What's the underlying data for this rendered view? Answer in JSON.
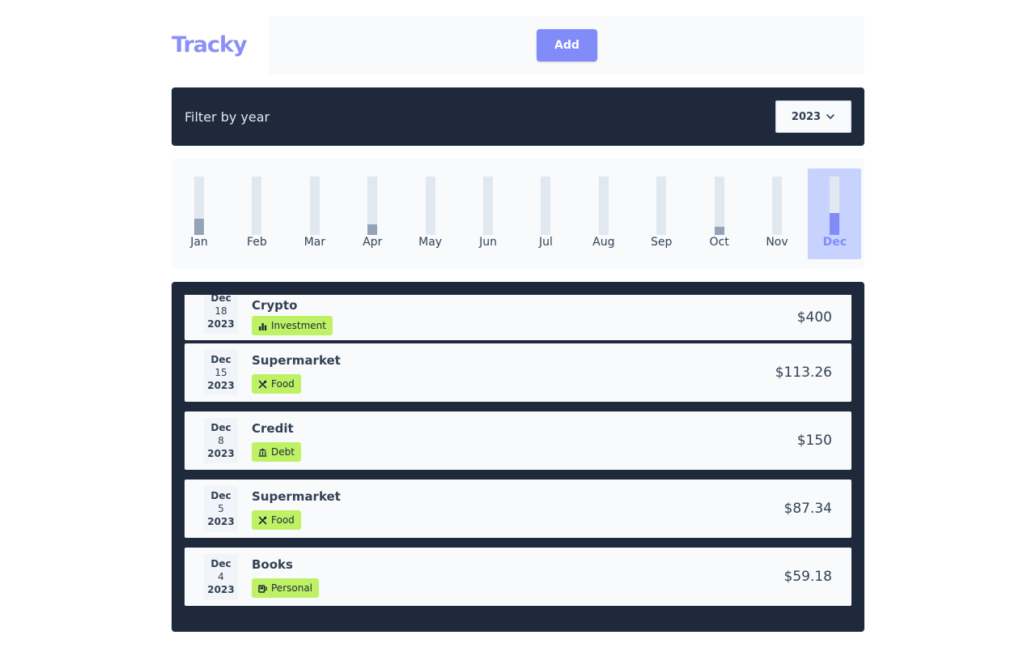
{
  "app": {
    "logo": "Tracky"
  },
  "header": {
    "add_label": "Add"
  },
  "filter": {
    "label": "Filter by year",
    "selected_year": "2023"
  },
  "colors": {
    "brand": "#8b8ff8",
    "accent": "#818cf8",
    "dark": "#1e293b",
    "bar_track": "#e2e8f0",
    "bar_fill": "#94a3b8",
    "selected_bg": "#c7d2fe",
    "badge": "#bef264"
  },
  "chart_data": {
    "type": "bar",
    "categories": [
      "Jan",
      "Feb",
      "Mar",
      "Apr",
      "May",
      "Jun",
      "Jul",
      "Aug",
      "Sep",
      "Oct",
      "Nov",
      "Dec"
    ],
    "values": [
      0.28,
      0,
      0,
      0.18,
      0,
      0,
      0,
      0,
      0,
      0.14,
      0,
      0.38
    ],
    "value_scale": "fraction of max",
    "selected": "Dec"
  },
  "expenses": [
    {
      "month": "Dec",
      "day": "18",
      "year": "2023",
      "title": "Crypto",
      "category": "Investment",
      "icon": "chart-icon",
      "amount": "$400"
    },
    {
      "month": "Dec",
      "day": "15",
      "year": "2023",
      "title": "Supermarket",
      "category": "Food",
      "icon": "utensils-icon",
      "amount": "$113.26"
    },
    {
      "month": "Dec",
      "day": "8",
      "year": "2023",
      "title": "Credit",
      "category": "Debt",
      "icon": "bank-icon",
      "amount": "$150"
    },
    {
      "month": "Dec",
      "day": "5",
      "year": "2023",
      "title": "Supermarket",
      "category": "Food",
      "icon": "utensils-icon",
      "amount": "$87.34"
    },
    {
      "month": "Dec",
      "day": "4",
      "year": "2023",
      "title": "Books",
      "category": "Personal",
      "icon": "mug-icon",
      "amount": "$59.18"
    }
  ]
}
